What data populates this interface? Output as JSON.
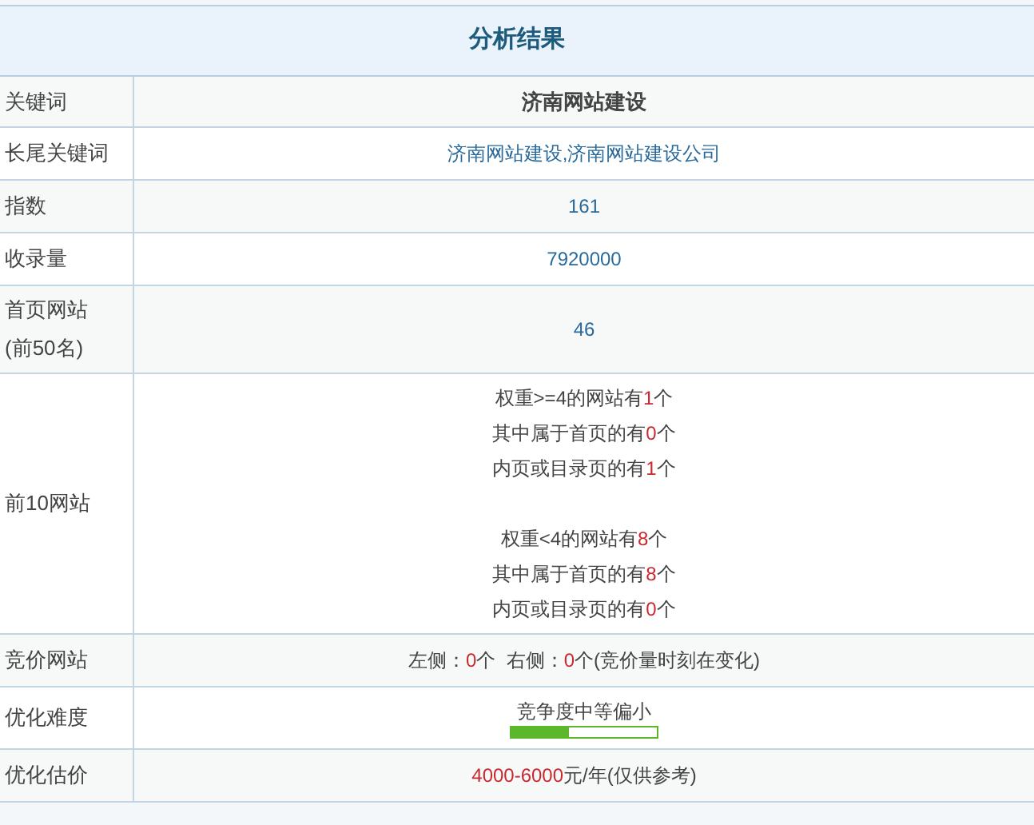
{
  "title": "分析结果",
  "rows": [
    {
      "label": "关键词",
      "kind": "bold",
      "value": "济南网站建设"
    },
    {
      "label": "长尾关键词",
      "kind": "link",
      "value": "济南网站建设,济南网站建设公司"
    },
    {
      "label": "指数",
      "kind": "link",
      "value": "161"
    },
    {
      "label": "收录量",
      "kind": "link",
      "value": "7920000"
    },
    {
      "label": "首页网站",
      "label_note": "(前50名)",
      "kind": "link",
      "value": "46"
    },
    {
      "label": "前10网站",
      "kind": "lines",
      "blocks": [
        [
          [
            {
              "text": "权重>=4的网站有",
              "emphasis": false
            },
            {
              "text": "1",
              "emphasis": true
            },
            {
              "text": "个",
              "emphasis": false
            }
          ],
          [
            {
              "text": "其中属于首页的有",
              "emphasis": false
            },
            {
              "text": "0",
              "emphasis": true
            },
            {
              "text": "个",
              "emphasis": false
            }
          ],
          [
            {
              "text": "内页或目录页的有",
              "emphasis": false
            },
            {
              "text": "1",
              "emphasis": true
            },
            {
              "text": "个",
              "emphasis": false
            }
          ]
        ],
        [
          [
            {
              "text": "权重<4的网站有",
              "emphasis": false
            },
            {
              "text": "8",
              "emphasis": true
            },
            {
              "text": "个",
              "emphasis": false
            }
          ],
          [
            {
              "text": "其中属于首页的有",
              "emphasis": false
            },
            {
              "text": "8",
              "emphasis": true
            },
            {
              "text": "个",
              "emphasis": false
            }
          ],
          [
            {
              "text": "内页或目录页的有",
              "emphasis": false
            },
            {
              "text": "0",
              "emphasis": true
            },
            {
              "text": "个",
              "emphasis": false
            }
          ]
        ]
      ]
    },
    {
      "label": "竞价网站",
      "kind": "lines",
      "blocks": [
        [
          [
            {
              "text": "左侧：",
              "emphasis": false
            },
            {
              "text": "0",
              "emphasis": true
            },
            {
              "text": "个  右侧：",
              "emphasis": false
            },
            {
              "text": "0",
              "emphasis": true
            },
            {
              "text": "个(竞价量时刻在变化)",
              "emphasis": false
            }
          ]
        ]
      ]
    },
    {
      "label": "优化难度",
      "kind": "meter",
      "value": "竞争度中等偏小",
      "level": 0.4
    },
    {
      "label": "优化估价",
      "kind": "lines",
      "blocks": [
        [
          [
            {
              "text": "4000-6000",
              "emphasis": true
            },
            {
              "text": "元/年(仅供参考)",
              "emphasis": false
            }
          ]
        ]
      ]
    }
  ]
}
